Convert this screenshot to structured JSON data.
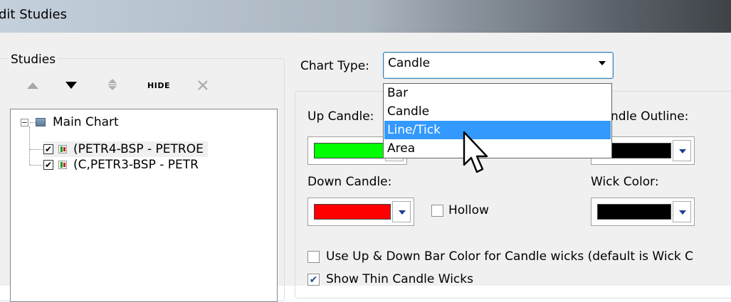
{
  "window": {
    "title": "dit Studies"
  },
  "studies": {
    "group_label": "Studies",
    "toolbar": {
      "hide_label": "HIDE"
    },
    "tree": {
      "root": {
        "label": "Main Chart",
        "expander": "−"
      },
      "items": [
        {
          "label": "(PETR4-BSP - PETROE",
          "checked": "✔"
        },
        {
          "label": "(C,PETR3-BSP - PETR",
          "checked": "✔"
        }
      ]
    }
  },
  "chart_type": {
    "label": "Chart Type:",
    "selected": "Candle",
    "options": [
      "Bar",
      "Candle",
      "Line/Tick",
      "Area"
    ],
    "highlighted": "Line/Tick"
  },
  "settings": {
    "up_candle": {
      "label": "Up Candle:",
      "color": "#00ff00"
    },
    "candle_outline": {
      "label": "ndle Outline:",
      "color": "#000000"
    },
    "down_candle": {
      "label": "Down Candle:",
      "color": "#ff0000"
    },
    "hollow": {
      "label": "Hollow",
      "checked": ""
    },
    "wick_color": {
      "label": "Wick Color:",
      "color": "#000000"
    },
    "use_updown_color": {
      "label": "Use Up & Down Bar Color for Candle wicks (default is Wick C",
      "checked": ""
    },
    "thin_wicks": {
      "label": "Show Thin Candle Wicks",
      "checked": "✔"
    }
  }
}
